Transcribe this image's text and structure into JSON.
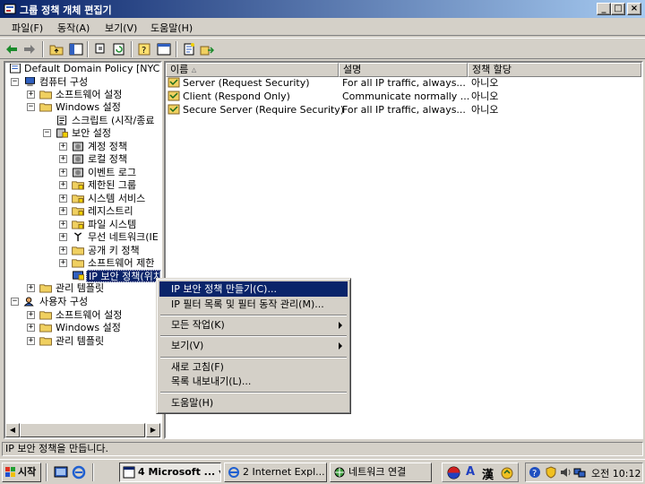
{
  "window": {
    "title": "그룹 정책 개체 편집기"
  },
  "menu": [
    "파일(F)",
    "동작(A)",
    "보기(V)",
    "도움말(H)"
  ],
  "tree": {
    "root": "Default Domain Policy [NYC-",
    "computer_config": "컴퓨터 구성",
    "software_settings": "소프트웨어 설정",
    "windows_settings": "Windows 설정",
    "scripts": "스크립트 (시작/종료",
    "security_settings": "보안 설정",
    "account_policy": "계정 정책",
    "local_policy": "로컬 정책",
    "event_log": "이벤트 로그",
    "restricted_groups": "제한된 그룹",
    "system_services": "시스템 서비스",
    "registry": "레지스트리",
    "file_system": "파일 시스템",
    "wireless": "무선 네트워크(IE",
    "public_key": "공개 키 정책",
    "software_restriction": "소프트웨어 제한",
    "ip_security": "IP 보안 정책(위치",
    "admin_templates": "관리 템플릿",
    "user_config": "사용자 구성",
    "u_software_settings": "소프트웨어 설정",
    "u_windows_settings": "Windows 설정",
    "u_admin_templates": "관리 템플릿"
  },
  "list": {
    "columns": [
      "이름",
      "설명",
      "정책 할당"
    ],
    "rows": [
      {
        "name": "Server (Request Security)",
        "desc": "For all IP traffic, always...",
        "assigned": "아니오"
      },
      {
        "name": "Client (Respond Only)",
        "desc": "Communicate normally ...",
        "assigned": "아니오"
      },
      {
        "name": "Secure Server (Require Security)",
        "desc": "For all IP traffic, always...",
        "assigned": "아니오"
      }
    ]
  },
  "context_menu": {
    "create": "IP 보안 정책 만들기(C)...",
    "manage": "IP 필터 목록 및 필터 동작 관리(M)...",
    "all_tasks": "모든 작업(K)",
    "view": "보기(V)",
    "refresh": "새로 고침(F)",
    "export": "목록 내보내기(L)...",
    "help": "도움말(H)"
  },
  "status": "IP 보안 정책을 만듭니다.",
  "taskbar": {
    "start": "시작",
    "tasks": [
      "4 Microsoft ...",
      "2 Internet Expl...",
      "네트워크 연결"
    ],
    "ime_a": "A",
    "ime_han": "漢",
    "clock": "오전 10:12"
  }
}
